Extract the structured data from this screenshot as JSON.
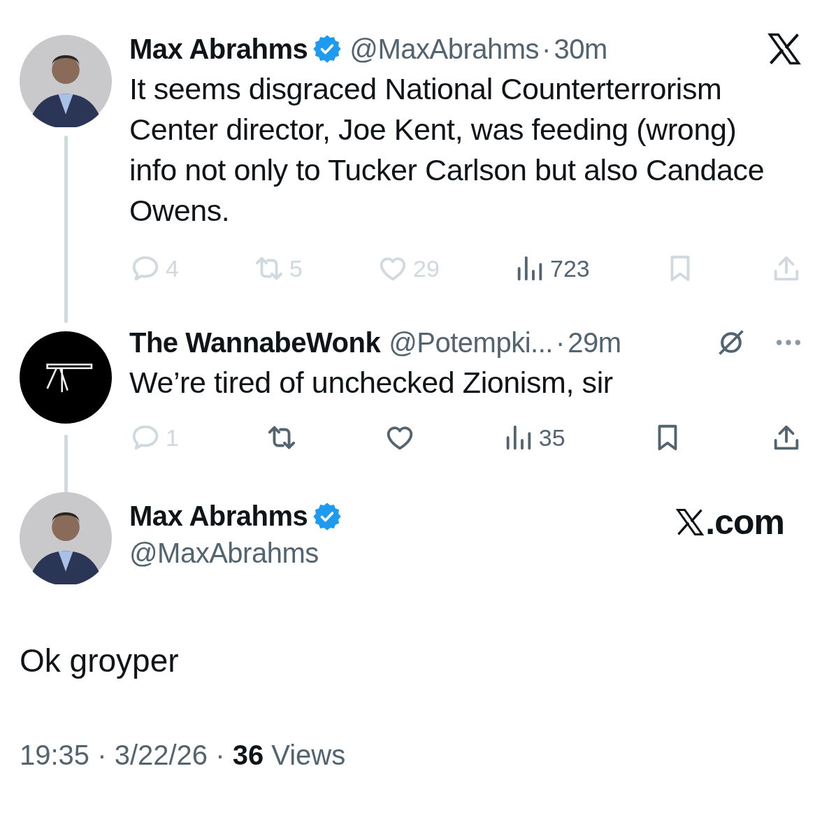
{
  "thread": [
    {
      "avatar": {
        "kind": "person"
      },
      "name": "Max Abrahms",
      "verified": true,
      "handle": "@MaxAbrahms",
      "separator": "·",
      "time": "30m",
      "header_icons": [
        {
          "kind": "x-logo"
        }
      ],
      "text": "It seems disgraced National Counterterrorism Center director, Joe Kent, was feeding (wrong) info not only to Tucker Carlson but also Candace Owens.",
      "actions": [
        {
          "kind": "reply",
          "count": "4",
          "dimmed": true
        },
        {
          "kind": "repost",
          "count": "5",
          "dimmed": true
        },
        {
          "kind": "like",
          "count": "29",
          "dimmed": true
        },
        {
          "kind": "views",
          "count": "723",
          "dimmed": false
        },
        {
          "kind": "bookmark",
          "dimmed": true
        },
        {
          "kind": "share",
          "dimmed": true
        }
      ]
    },
    {
      "avatar": {
        "kind": "emblem"
      },
      "name": "The WannabeWonk",
      "verified": false,
      "handle": "@Potempki...",
      "separator": "·",
      "time": "29m",
      "header_icons": [
        {
          "kind": "slash-circle"
        },
        {
          "kind": "more"
        }
      ],
      "text": "We’re tired of unchecked Zionism, sir",
      "actions": [
        {
          "kind": "reply",
          "count": "1",
          "dimmed": true
        },
        {
          "kind": "repost",
          "dimmed": false
        },
        {
          "kind": "like",
          "dimmed": false
        },
        {
          "kind": "views",
          "count": "35",
          "dimmed": false
        },
        {
          "kind": "bookmark",
          "dimmed": false
        },
        {
          "kind": "share",
          "dimmed": false
        }
      ]
    }
  ],
  "main_tweet": {
    "avatar": {
      "kind": "person"
    },
    "name": "Max Abrahms",
    "verified": true,
    "handle": "@MaxAbrahms",
    "brand": ".com",
    "text": "Ok groyper",
    "footer": "19:35 · 3/22/26 · **36** Views"
  }
}
